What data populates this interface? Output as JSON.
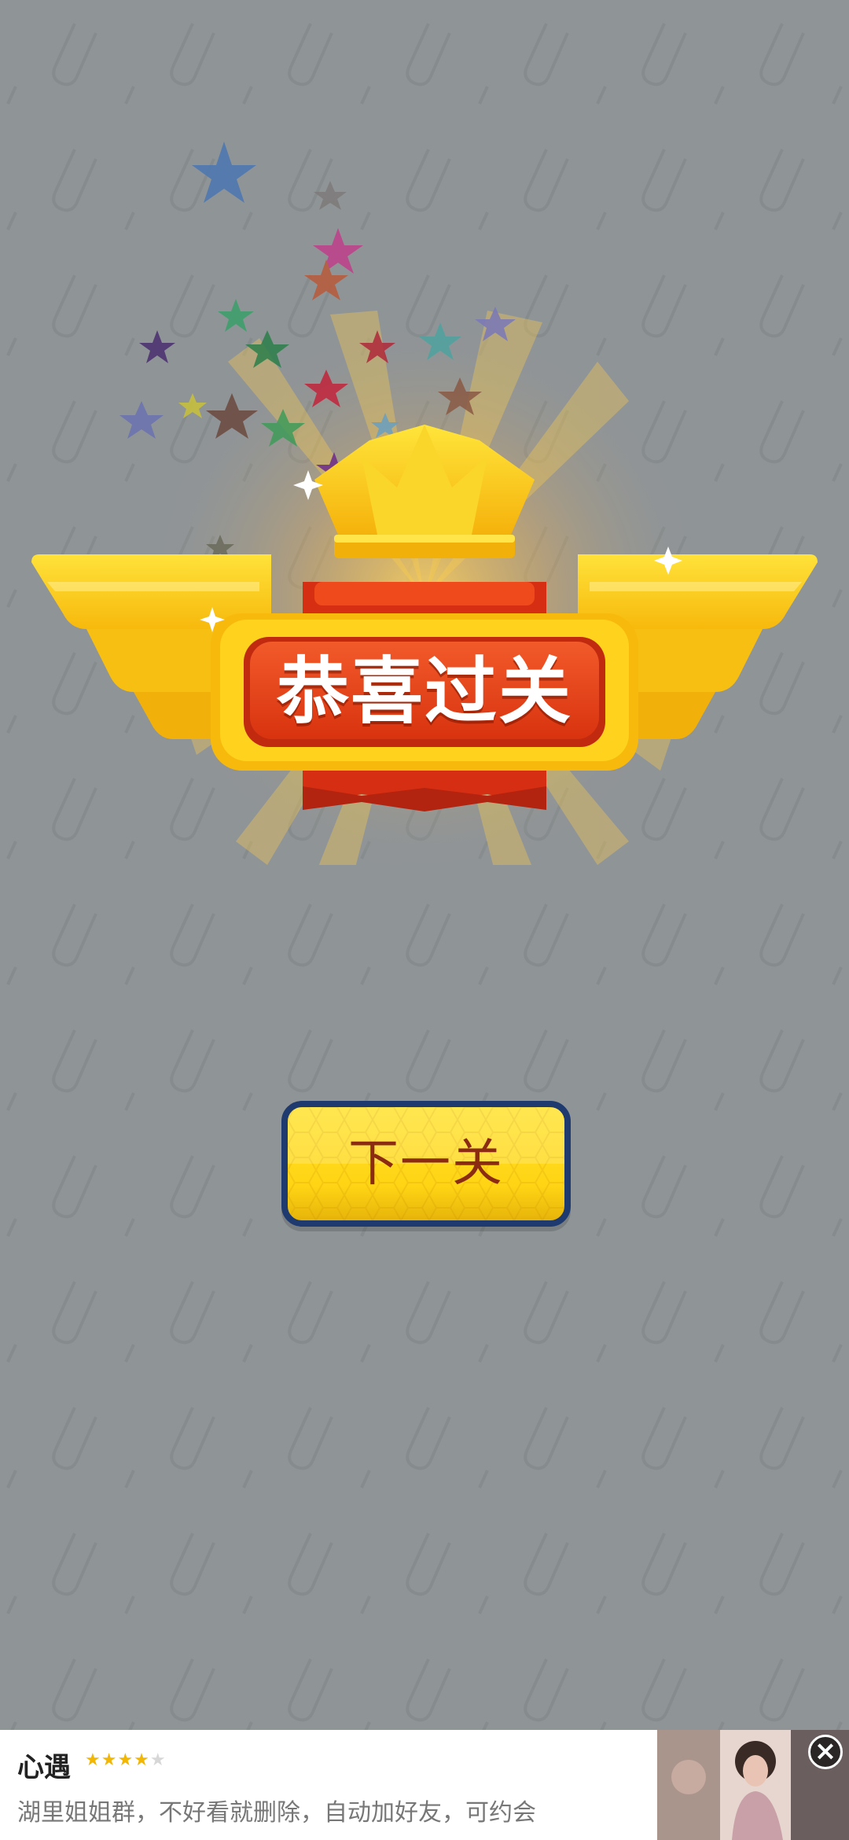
{
  "victory": {
    "title": "恭喜过关"
  },
  "next_button": {
    "label": "下一关"
  },
  "ad": {
    "title": "心遇",
    "rating_filled": "★★★★",
    "rating_empty": "★",
    "description": "湖里姐姐群，不好看就删除，自动加好友，可约会",
    "close_icon": "close-icon"
  },
  "colors": {
    "background": "#8f9497",
    "gold": "#ffd414",
    "ribbon_red": "#e8401c",
    "button_border": "#1e3a6e",
    "button_text": "#8a2b12"
  }
}
